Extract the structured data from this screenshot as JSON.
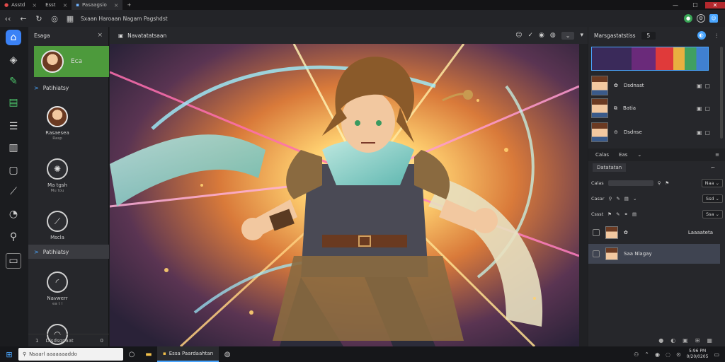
{
  "titlebar": {
    "tabs": [
      {
        "label": "Asstd",
        "active": false
      },
      {
        "label": "Esst",
        "active": false
      },
      {
        "label": "Pasaagsio",
        "active": true
      }
    ],
    "new_tab": "+",
    "window_buttons": [
      "—",
      "☐",
      "✕"
    ]
  },
  "toolbar": {
    "breadcrumb": "Sxaan Haroaan Nagam Pagshdst",
    "icons": [
      "back-icon",
      "forward-icon",
      "refresh-icon",
      "view-icon"
    ]
  },
  "rail": {
    "icons": [
      "bucket-icon",
      "layers-icon",
      "brush-icon",
      "grid-icon",
      "list-icon",
      "book-icon",
      "frame-icon",
      "tool-icon",
      "dial-icon",
      "zoom-icon",
      "terminal-icon"
    ]
  },
  "left_panel": {
    "title": "Esaga",
    "close": "×",
    "selected_card": {
      "label": "Eca"
    },
    "section1": "Patihiatsy",
    "items": [
      {
        "label": "Rasaesea",
        "sub": "Rasp"
      },
      {
        "label": "Ma tgsh",
        "sub": "Mu tou"
      },
      {
        "label": "Mscla",
        "sub": ""
      }
    ],
    "section2": "Patihiatsy",
    "items2": [
      {
        "label": "Navwerr",
        "sub": "ea t l"
      }
    ],
    "footer": {
      "count": "1",
      "label": "Disdsgnaat",
      "value": "0"
    }
  },
  "canvas_header": {
    "title": "Navatatatsaan",
    "icons": [
      "smile-icon",
      "check-icon",
      "face-icon",
      "palette-icon"
    ],
    "dropdown": "⌄"
  },
  "right_panel": {
    "title": "Marsgastatstiss",
    "zoom_value": "5",
    "rows": [
      {
        "label": "Dsdnast"
      },
      {
        "label": "Batia"
      },
      {
        "label": "Dsdnse"
      }
    ],
    "tabs": [
      "Calas",
      "Eas"
    ],
    "subtab": "Datatatan",
    "props": [
      {
        "label": "Calas",
        "value": "Naa"
      },
      {
        "label": "Casar",
        "value": "Ssd"
      },
      {
        "label": "Cssst",
        "value": "Ssa"
      }
    ],
    "layers": [
      {
        "label": "Laaaateta",
        "highlighted": false
      },
      {
        "label": "Saa Nlagay",
        "highlighted": true
      }
    ]
  },
  "taskbar": {
    "search_placeholder": "Nsaarl aaaaaaaddo",
    "active_app": "Essa Paardaahtan",
    "time": "5:96 PM",
    "date": "0/20/0205"
  },
  "colors": {
    "accent": "#4aa6ff",
    "selected_card": "#4d9a3c",
    "close_button": "#b3282d"
  }
}
